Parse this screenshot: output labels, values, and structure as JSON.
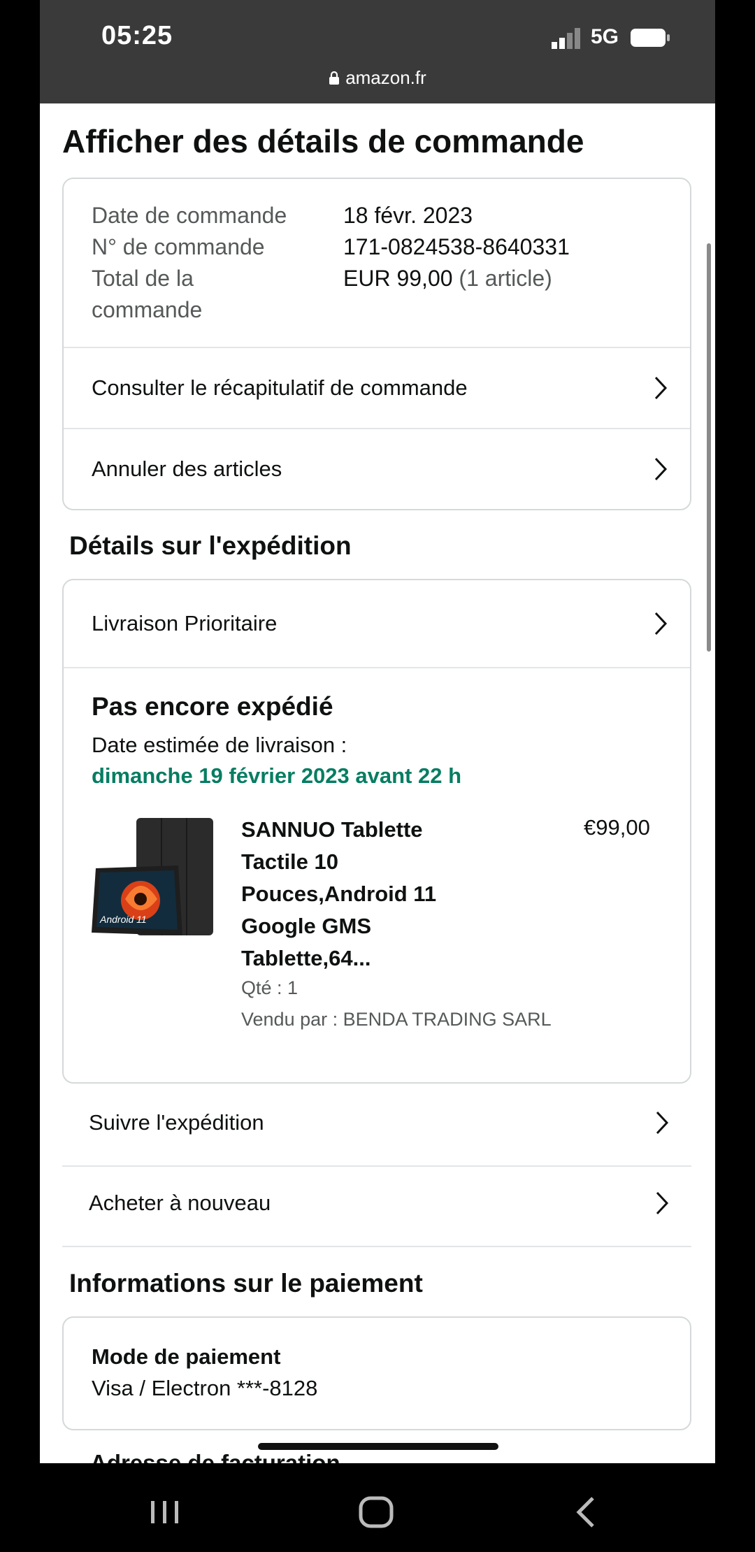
{
  "status_bar": {
    "time": "05:25",
    "network": "5G"
  },
  "browser": {
    "url": "amazon.fr"
  },
  "page_title": "Afficher des détails de commande",
  "order_summary": {
    "date_label": "Date de commande",
    "date_value": "18 févr. 2023",
    "number_label": "N° de commande",
    "number_value": "171-0824538-8640331",
    "total_label_line1": "Total de la",
    "total_label_line2": "commande",
    "total_value": "EUR 99,00",
    "total_items": "(1 article)",
    "links": [
      "Consulter le récapitulatif de commande",
      "Annuler des articles"
    ]
  },
  "shipping": {
    "section_title": "Détails sur l'expédition",
    "method": "Livraison Prioritaire",
    "status": "Pas encore expédié",
    "estimate_label": "Date estimée de livraison :",
    "estimate_date": "dimanche 19 février 2023 avant 22 h",
    "product": {
      "title_lines": [
        "SANNUO Tablette",
        "Tactile 10",
        "Pouces,Android 11",
        "Google GMS",
        "Tablette,64..."
      ],
      "price": "€99,00",
      "qty": "Qté : 1",
      "seller": "Vendu par : BENDA TRADING SARL",
      "image_text": "Android 11"
    },
    "actions": [
      "Suivre l'expédition",
      "Acheter à nouveau"
    ]
  },
  "payment": {
    "section_title": "Informations sur le paiement",
    "method_label": "Mode de paiement",
    "method_value": "Visa / Electron ***-8128"
  },
  "next_section_partial": "Adresse de facturation",
  "colors": {
    "delivery_green": "#067d62",
    "status_bar": "#3a3a3a",
    "card_border": "#d5d9d9"
  }
}
